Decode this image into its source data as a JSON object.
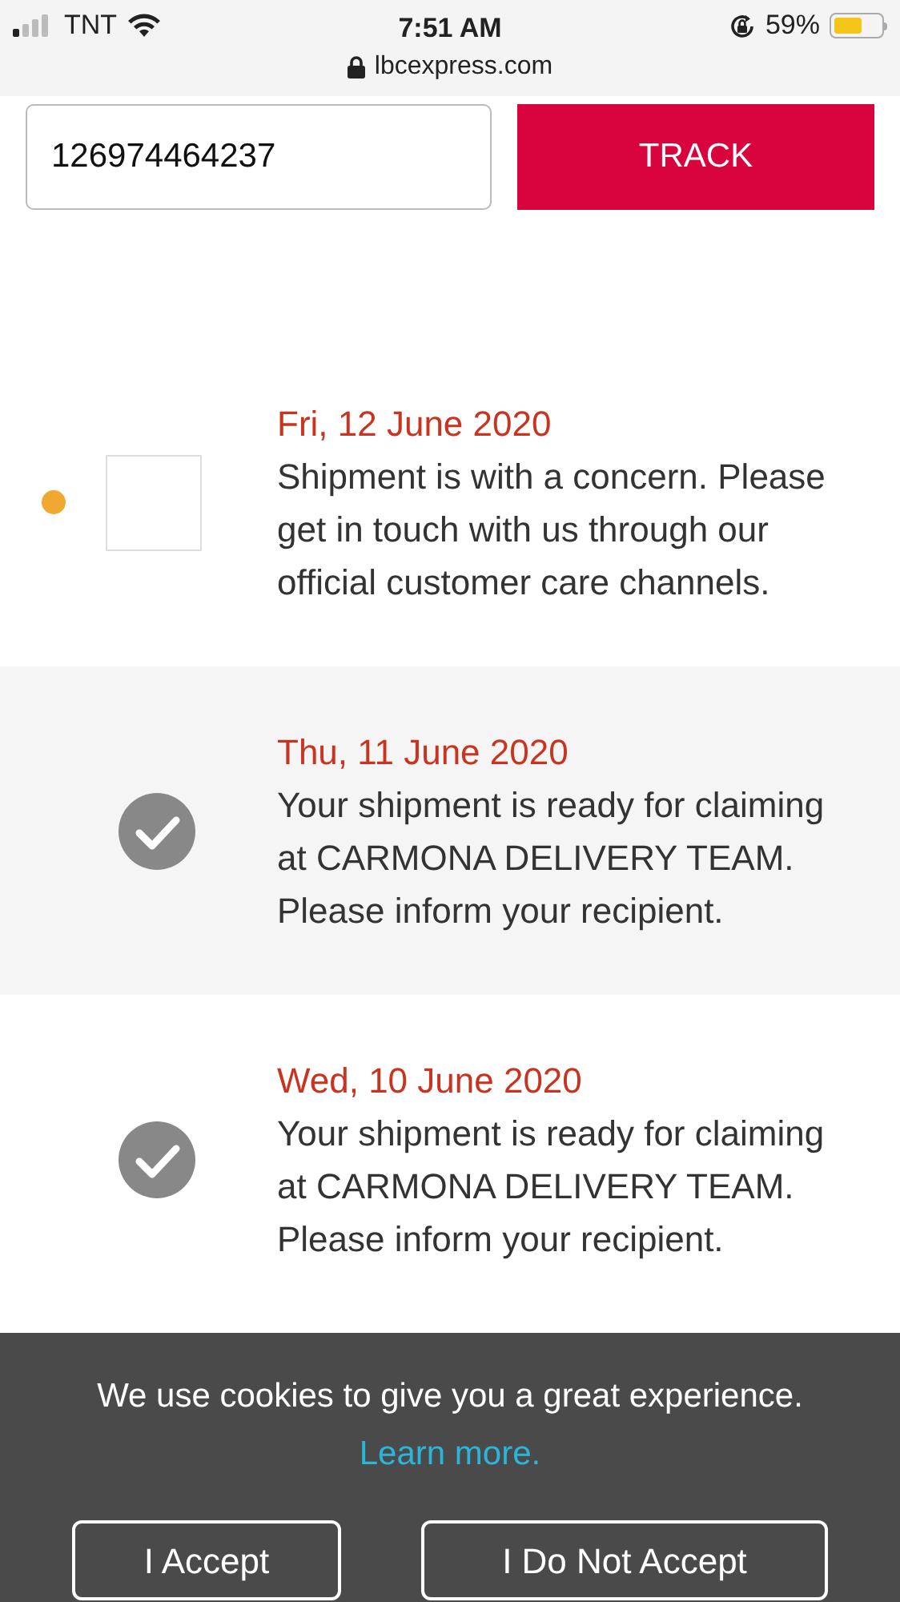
{
  "status_bar": {
    "carrier": "TNT",
    "time": "7:51 AM",
    "battery": "59%",
    "url": "lbcexpress.com"
  },
  "tracking": {
    "value": "126974464237",
    "button": "TRACK"
  },
  "events": [
    {
      "kind": "concern",
      "date": "Fri, 12 June 2020",
      "message": "Shipment is with a concern. Please get in touch with us through our official customer care channels."
    },
    {
      "kind": "done",
      "date": "Thu, 11 June 2020",
      "message": "Your shipment is ready for claiming at CARMONA DELIVERY TEAM. Please inform your recipient."
    },
    {
      "kind": "done",
      "date": "Wed, 10 June 2020",
      "message": "Your shipment is ready for claiming at CARMONA DELIVERY TEAM. Please inform your recipient."
    }
  ],
  "cookie_banner": {
    "text": "We use cookies to give you a great experience.",
    "link": "Learn more.",
    "buttons": [
      "I Accept",
      "I Do Not Accept"
    ]
  }
}
